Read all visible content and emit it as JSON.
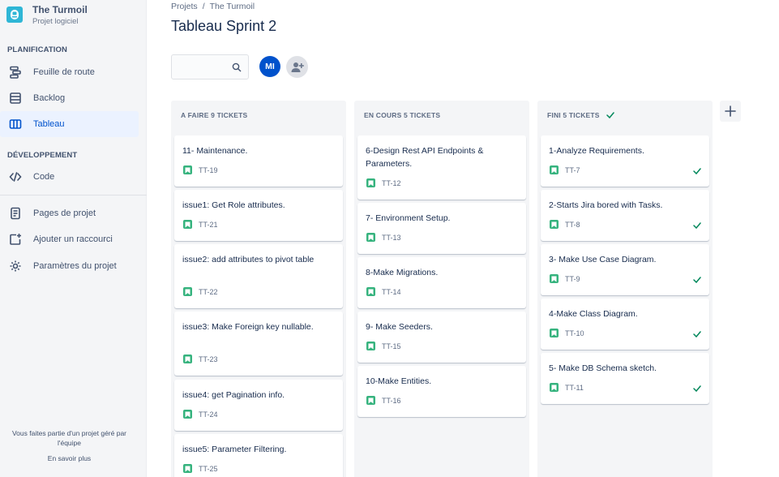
{
  "project": {
    "name": "The Turmoil",
    "type": "Projet logiciel"
  },
  "sidebar": {
    "planning_title": "PLANIFICATION",
    "planning_items": [
      {
        "label": "Feuille de route",
        "icon": "roadmap-icon"
      },
      {
        "label": "Backlog",
        "icon": "backlog-icon"
      },
      {
        "label": "Tableau",
        "icon": "board-icon",
        "active": true
      }
    ],
    "dev_title": "DÉVELOPPEMENT",
    "dev_items": [
      {
        "label": "Code",
        "icon": "code-icon"
      }
    ],
    "other_items": [
      {
        "label": "Pages de projet",
        "icon": "page-icon"
      },
      {
        "label": "Ajouter un raccourci",
        "icon": "add-shortcut-icon"
      },
      {
        "label": "Paramètres du projet",
        "icon": "gear-icon"
      }
    ],
    "footer_note": "Vous faites partie d'un projet géré par l'équipe",
    "footer_link": "En savoir plus"
  },
  "breadcrumb": {
    "root": "Projets",
    "separator": "/",
    "current": "The Turmoil"
  },
  "page_title": "Tableau Sprint 2",
  "search": {
    "placeholder": "",
    "value": ""
  },
  "users": {
    "avatar_initials": "MI"
  },
  "colors": {
    "accent": "#0052cc",
    "story": "#36b37e",
    "done": "#00875a",
    "column_bg": "#f4f5f7"
  },
  "columns": [
    {
      "title": "A FAIRE 9 TICKETS",
      "done": false,
      "cards": [
        {
          "title": "11- Maintenance.",
          "key": "TT-19"
        },
        {
          "title": "issue1: Get Role attributes.",
          "key": "TT-21"
        },
        {
          "title": "issue2: add attributes to pivot table",
          "key": "TT-22"
        },
        {
          "title": "issue3: Make Foreign key nullable.",
          "key": "TT-23"
        },
        {
          "title": "issue4: get Pagination info.",
          "key": "TT-24"
        },
        {
          "title": "issue5: Parameter Filtering.",
          "key": "TT-25"
        }
      ]
    },
    {
      "title": "EN COURS 5 TICKETS",
      "done": false,
      "cards": [
        {
          "title": "6-Design Rest API Endpoints & Parameters.",
          "key": "TT-12"
        },
        {
          "title": "7- Environment Setup.",
          "key": "TT-13"
        },
        {
          "title": "8-Make Migrations.",
          "key": "TT-14"
        },
        {
          "title": "9- Make Seeders.",
          "key": "TT-15"
        },
        {
          "title": "10-Make Entities.",
          "key": "TT-16"
        }
      ]
    },
    {
      "title": "FINI 5 TICKETS",
      "done": true,
      "cards": [
        {
          "title": "1-Analyze Requirements.",
          "key": "TT-7"
        },
        {
          "title": "2-Starts Jira bored with Tasks.",
          "key": "TT-8"
        },
        {
          "title": "3- Make Use Case Diagram.",
          "key": "TT-9"
        },
        {
          "title": "4-Make Class Diagram.",
          "key": "TT-10"
        },
        {
          "title": "5- Make DB Schema sketch.",
          "key": "TT-11"
        }
      ]
    }
  ]
}
